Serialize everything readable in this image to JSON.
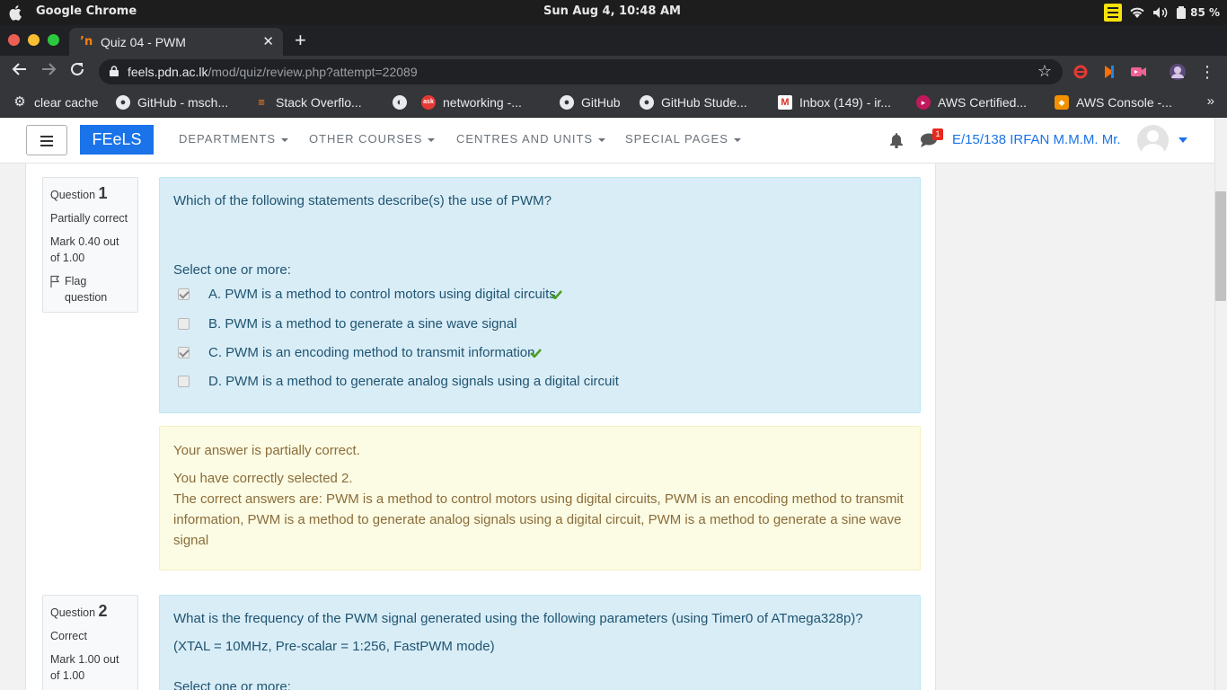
{
  "os": {
    "app_name": "Google Chrome",
    "clock": "Sun Aug  4, 10:48 AM",
    "battery": "85 %"
  },
  "browser": {
    "tab_title": "Quiz 04 - PWM",
    "tab_favicon": "’n",
    "url_host": "feels.pdn.ac.lk",
    "url_path": "/mod/quiz/review.php?attempt=22089"
  },
  "bookmarks": [
    {
      "label": "clear cache",
      "icon": "gear-icon"
    },
    {
      "label": "GitHub - msch...",
      "icon": "github-icon"
    },
    {
      "label": "Stack Overflo...",
      "icon": "stackoverflow-icon"
    },
    {
      "label": "",
      "icon": "globe-icon"
    },
    {
      "label": "networking -...",
      "icon": "ask-icon"
    },
    {
      "label": "GitHub",
      "icon": "github-icon"
    },
    {
      "label": "GitHub Stude...",
      "icon": "github-icon"
    },
    {
      "label": "Inbox (149) - ir...",
      "icon": "gmail-icon"
    },
    {
      "label": "AWS Certified...",
      "icon": "aws-certified-icon"
    },
    {
      "label": "AWS Console -...",
      "icon": "aws-console-icon"
    }
  ],
  "site": {
    "brand": "FEeLS",
    "menu": [
      "DEPARTMENTS",
      "OTHER COURSES",
      "CENTRES AND UNITS",
      "SPECIAL PAGES"
    ],
    "message_count": "1",
    "user": "E/15/138 IRFAN M.M.M. Mr."
  },
  "questions": [
    {
      "label": "Question",
      "number": "1",
      "state": "Partially correct",
      "mark": "Mark 0.40 out of 1.00",
      "flag": "Flag question",
      "text": "Which of the following statements describe(s) the use of PWM?",
      "prompt": "Select one or more:",
      "options": [
        {
          "text": "A. PWM is a method to control motors using digital circuits",
          "checked": true,
          "correct_mark": true
        },
        {
          "text": "B. PWM is a method to generate a sine wave signal",
          "checked": false,
          "correct_mark": false
        },
        {
          "text": "C. PWM is an encoding method to transmit information",
          "checked": true,
          "correct_mark": true
        },
        {
          "text": "D. PWM is a method to generate analog signals using a digital circuit",
          "checked": false,
          "correct_mark": false
        }
      ],
      "feedback": {
        "summary": "Your answer is partially correct.",
        "selected": "You have correctly selected 2.",
        "correct_answers": "The correct answers are: PWM is a method to control motors using digital circuits, PWM is an encoding method to transmit information, PWM is a method to generate analog signals using a digital circuit, PWM is a method to generate a sine wave signal"
      }
    },
    {
      "label": "Question",
      "number": "2",
      "state": "Correct",
      "mark": "Mark 1.00 out of 1.00",
      "text": "What is the frequency of the PWM signal generated using the following parameters (using Timer0 of ATmega328p)?",
      "params": "(XTAL = 10MHz, Pre-scalar = 1:256, FastPWM mode)",
      "prompt": "Select one or more:"
    }
  ]
}
